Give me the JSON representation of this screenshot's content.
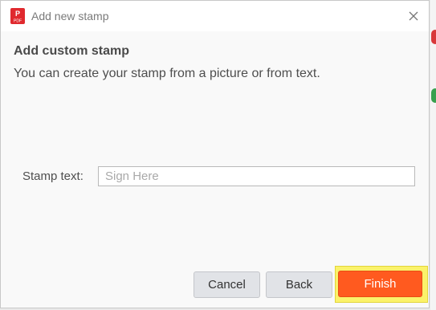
{
  "window": {
    "title": "Add new stamp",
    "icon": "pdf-app-icon",
    "icon_caption": "PDF",
    "close_icon": "close-icon"
  },
  "content": {
    "heading": "Add custom stamp",
    "description": "You can create your stamp from a picture or from text."
  },
  "stamp_field": {
    "label": "Stamp text:",
    "placeholder": "Sign Here",
    "value": ""
  },
  "buttons": {
    "cancel": "Cancel",
    "back": "Back",
    "finish": "Finish"
  },
  "colors": {
    "primary": "#ff5a1f",
    "highlight": "#fbf26a",
    "app_icon": "#e0292e"
  }
}
